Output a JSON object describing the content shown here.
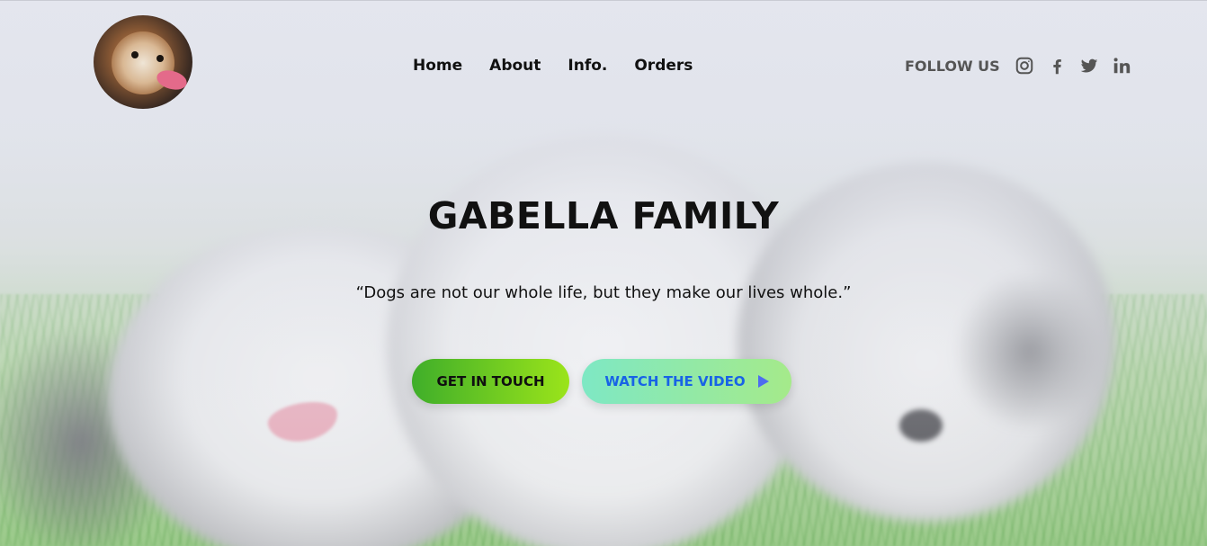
{
  "header": {
    "logo_alt": "dog-avatar",
    "nav": [
      {
        "label": "Home"
      },
      {
        "label": "About"
      },
      {
        "label": "Info."
      },
      {
        "label": "Orders"
      }
    ],
    "follow_label": "FOLLOW US",
    "social_icons": [
      "instagram-icon",
      "facebook-icon",
      "twitter-icon",
      "linkedin-icon"
    ]
  },
  "hero": {
    "title": "GABELLA FAMILY",
    "quote": "“Dogs are not our whole life, but they make our lives whole.”",
    "buttons": {
      "get_in_touch": "GET IN TOUCH",
      "watch_video": "WATCH THE VIDEO"
    }
  },
  "colors": {
    "nav_text": "#111111",
    "follow_text": "#555555",
    "touch_gradient_start": "#3fae2a",
    "touch_gradient_end": "#9be41a",
    "video_gradient_start": "#7ee8c4",
    "video_gradient_end": "#a5ea8a",
    "video_text": "#1863e6",
    "play_icon": "#4d6cf0"
  }
}
